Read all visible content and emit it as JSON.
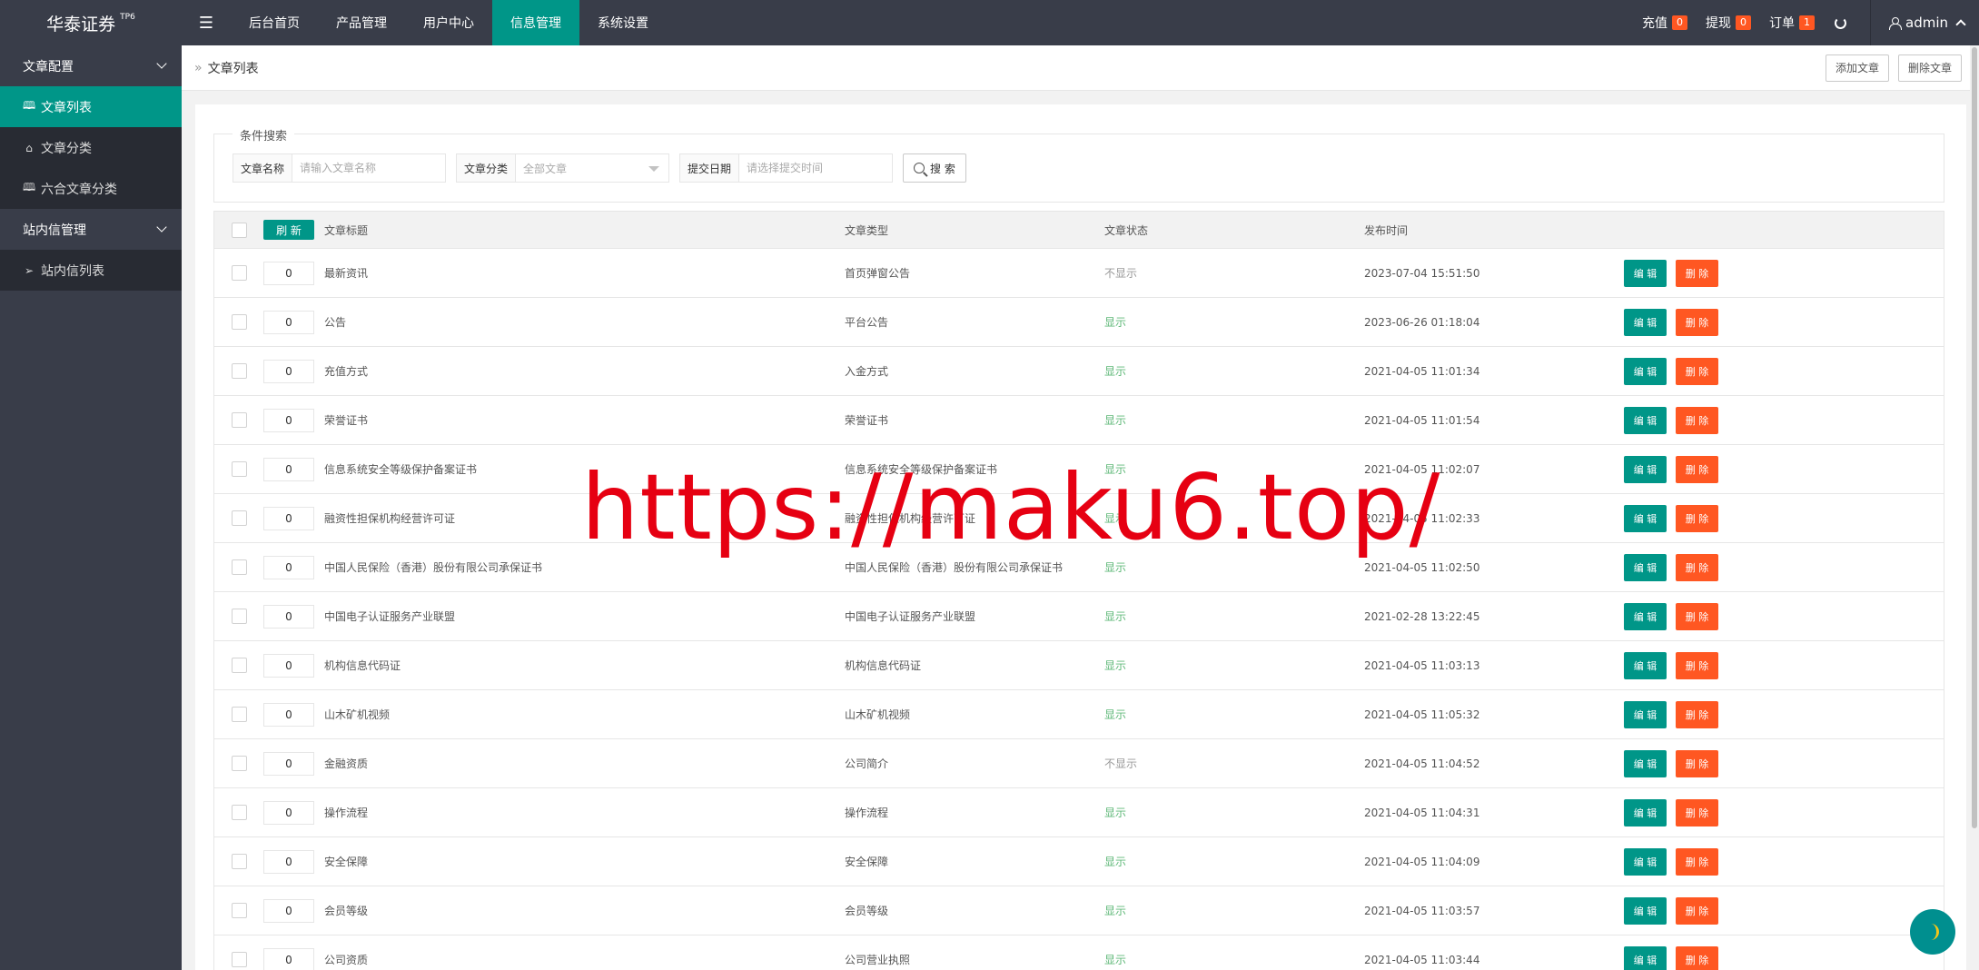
{
  "brand": {
    "name": "华泰证券",
    "version": "TP6"
  },
  "topnav": [
    {
      "label": "后台首页",
      "active": false
    },
    {
      "label": "产品管理",
      "active": false
    },
    {
      "label": "用户中心",
      "active": false
    },
    {
      "label": "信息管理",
      "active": true
    },
    {
      "label": "系统设置",
      "active": false
    }
  ],
  "topright": {
    "recharge": {
      "label": "充值",
      "count": "0"
    },
    "withdraw": {
      "label": "提现",
      "count": "0"
    },
    "order": {
      "label": "订单",
      "count": "1"
    },
    "user": "admin"
  },
  "sidebar": {
    "groups": [
      {
        "label": "文章配置",
        "items": [
          {
            "label": "文章列表",
            "icon": "book-icon",
            "active": true
          },
          {
            "label": "文章分类",
            "icon": "tag-icon",
            "active": false
          },
          {
            "label": "六合文章分类",
            "icon": "book-icon",
            "active": false
          }
        ]
      },
      {
        "label": "站内信管理",
        "items": [
          {
            "label": "站内信列表",
            "icon": "paper-plane-icon",
            "active": false
          }
        ]
      }
    ]
  },
  "breadcrumb": "文章列表",
  "header_buttons": {
    "add": "添加文章",
    "delete": "删除文章"
  },
  "search": {
    "legend": "条件搜索",
    "name_label": "文章名称",
    "name_placeholder": "请输入文章名称",
    "category_label": "文章分类",
    "category_value": "全部文章",
    "date_label": "提交日期",
    "date_placeholder": "请选择提交时间",
    "button": "搜 索"
  },
  "table": {
    "refresh_label": "刷 新",
    "headers": {
      "title": "文章标题",
      "type": "文章类型",
      "status": "文章状态",
      "time": "发布时间"
    },
    "edit_label": "编 辑",
    "delete_label": "删 除",
    "rows": [
      {
        "sort": "0",
        "title": "最新资讯",
        "type": "首页弹窗公告",
        "status": "不显示",
        "shown": false,
        "time": "2023-07-04 15:51:50"
      },
      {
        "sort": "0",
        "title": "公告",
        "type": "平台公告",
        "status": "显示",
        "shown": true,
        "time": "2023-06-26 01:18:04"
      },
      {
        "sort": "0",
        "title": "充值方式",
        "type": "入金方式",
        "status": "显示",
        "shown": true,
        "time": "2021-04-05 11:01:34"
      },
      {
        "sort": "0",
        "title": "荣誉证书",
        "type": "荣誉证书",
        "status": "显示",
        "shown": true,
        "time": "2021-04-05 11:01:54"
      },
      {
        "sort": "0",
        "title": "信息系统安全等级保护备案证书",
        "type": "信息系统安全等级保护备案证书",
        "status": "显示",
        "shown": true,
        "time": "2021-04-05 11:02:07"
      },
      {
        "sort": "0",
        "title": "融资性担保机构经营许可证",
        "type": "融资性担保机构经营许可证",
        "status": "显示",
        "shown": true,
        "time": "2021-04-05 11:02:33"
      },
      {
        "sort": "0",
        "title": "中国人民保险（香港）股份有限公司承保证书",
        "type": "中国人民保险（香港）股份有限公司承保证书",
        "status": "显示",
        "shown": true,
        "time": "2021-04-05 11:02:50"
      },
      {
        "sort": "0",
        "title": "中国电子认证服务产业联盟",
        "type": "中国电子认证服务产业联盟",
        "status": "显示",
        "shown": true,
        "time": "2021-02-28 13:22:45"
      },
      {
        "sort": "0",
        "title": "机构信息代码证",
        "type": "机构信息代码证",
        "status": "显示",
        "shown": true,
        "time": "2021-04-05 11:03:13"
      },
      {
        "sort": "0",
        "title": "山木矿机视频",
        "type": "山木矿机视频",
        "status": "显示",
        "shown": true,
        "time": "2021-04-05 11:05:32"
      },
      {
        "sort": "0",
        "title": "金融资质",
        "type": "公司简介",
        "status": "不显示",
        "shown": false,
        "time": "2021-04-05 11:04:52"
      },
      {
        "sort": "0",
        "title": "操作流程",
        "type": "操作流程",
        "status": "显示",
        "shown": true,
        "time": "2021-04-05 11:04:31"
      },
      {
        "sort": "0",
        "title": "安全保障",
        "type": "安全保障",
        "status": "显示",
        "shown": true,
        "time": "2021-04-05 11:04:09"
      },
      {
        "sort": "0",
        "title": "会员等级",
        "type": "会员等级",
        "status": "显示",
        "shown": true,
        "time": "2021-04-05 11:03:57"
      },
      {
        "sort": "0",
        "title": "公司资质",
        "type": "公司营业执照",
        "status": "显示",
        "shown": true,
        "time": "2021-04-05 11:03:44"
      }
    ]
  },
  "watermark": "https://maku6.top/",
  "colors": {
    "dark": "#393d49",
    "accent": "#009688",
    "danger": "#ff5722",
    "show": "#5fb878"
  }
}
